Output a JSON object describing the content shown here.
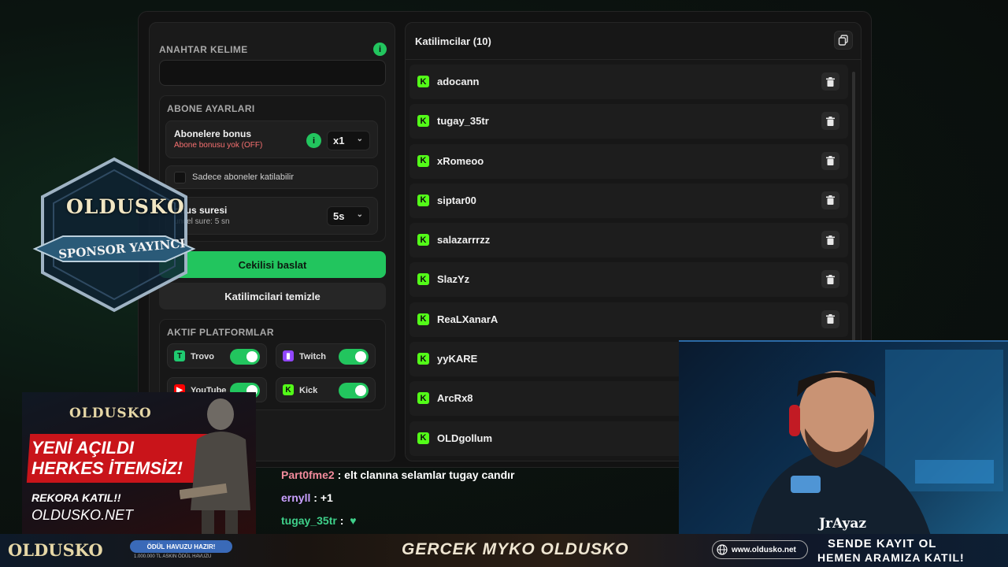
{
  "keyword": {
    "title": "ANAHTAR KELIME",
    "info": "i",
    "value": "",
    "placeholder": ""
  },
  "subscriber": {
    "title": "ABONE AYARLARI",
    "bonus_label": "Abonelere bonus",
    "bonus_status": "Abone bonusu yok (OFF)",
    "bonus_multiplier": "x1",
    "only_subs_label": "Sadece aboneler katilabilir",
    "countdown_label": "onus suresi",
    "countdown_sub": "uncel sure: 5 sn",
    "countdown_value": "5s",
    "info": "i"
  },
  "actions": {
    "start": "Cekilisi baslat",
    "clear": "Katilimcilari temizle"
  },
  "platforms": {
    "title": "AKTIF PLATFORMLAR",
    "items": [
      {
        "name": "Trovo",
        "enabled": true
      },
      {
        "name": "Twitch",
        "enabled": true
      },
      {
        "name": "YouTube",
        "enabled": true
      },
      {
        "name": "Kick",
        "enabled": true
      }
    ]
  },
  "participants": {
    "title": "Katilimcilar (10)",
    "names": [
      "adocann",
      "tugay_35tr",
      "xRomeoo",
      "siptar00",
      "salazarrrzz",
      "SlazYz",
      "ReaLXanarA",
      "yyKARE",
      "ArcRx8",
      "OLDgollum"
    ]
  },
  "sponsor": {
    "logo": "OLDUSKO",
    "ribbon": "SPONSOR YAYINCI"
  },
  "promo": {
    "logo": "OLDUSKO",
    "line1": "YENİ AÇILDI",
    "line2": "HERKES İTEMSİZ!",
    "line3": "REKORA KATIL!!",
    "line4": "OLDUSKO.NET"
  },
  "chat": [
    {
      "user": "Part0fme2",
      "sep": " : ",
      "text": "elt clanına selamlar tugay candır",
      "color": "#f28b9c"
    },
    {
      "user": "ernyll",
      "sep": " : ",
      "text": "+1",
      "color": "#c9a0ff"
    },
    {
      "user": "tugay_35tr",
      "sep": " : ",
      "text": "",
      "color": "#3fd08a",
      "emote": "heart-icon"
    }
  ],
  "webcam": {
    "name": "JrAyaz"
  },
  "footer": {
    "logo": "OLDUSKO",
    "pool": "ÖDÜL HAVUZU HAZIR!",
    "pool_sub": "1.000.000 TL ASKIN ÖDÜL HAVUZU",
    "center": "GERCEK MYKO OLDUSKO",
    "url": "www.oldusko.net",
    "cta1": "SENDE KAYIT OL",
    "cta2": "HEMEN ARAMIZA KATIL!"
  },
  "colors": {
    "accent": "#22c55e",
    "kick": "#53fc18",
    "danger_text": "#f87171"
  }
}
